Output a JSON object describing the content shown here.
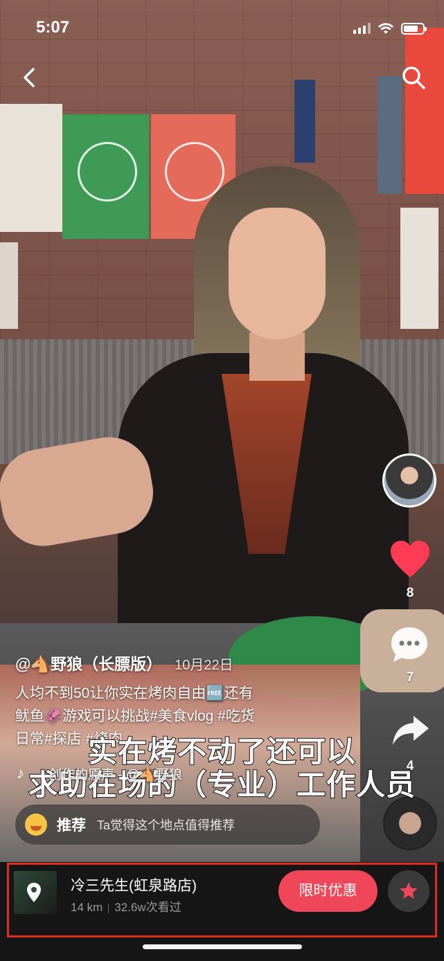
{
  "status_bar": {
    "time": "5:07",
    "battery_percent": 75
  },
  "author": {
    "handle": "@🐴野狼（长膘版）",
    "date": "10月22日"
  },
  "description": {
    "line1": "人均不到50让你实在烤肉自由🆓还有",
    "line2": "鱿鱼🦑游戏可以挑战#美食vlog #吃货",
    "line3": "日常#探店 #烤肉"
  },
  "subtitles": {
    "line1": "实在烤不动了还可以",
    "line2": "求助在场的（专业）工作人员"
  },
  "music": {
    "text": "创作的原声 - @🐴野狼"
  },
  "actions": {
    "likes": "8",
    "comments": "7",
    "shares": "4"
  },
  "recommendation": {
    "title": "推荐",
    "text": "Ta觉得这个地点值得推荐"
  },
  "shop": {
    "name": "冷三先生(虹泉路店)",
    "distance": "14 km",
    "views": "32.6w次看过",
    "promo_label": "限时优惠"
  },
  "colors": {
    "accent": "#f0465a",
    "highlight_box": "#e12b1f",
    "like": "#ff3b55"
  },
  "icons": [
    "back-icon",
    "search-icon",
    "heart-icon",
    "comment-icon",
    "share-icon",
    "music-note-icon",
    "location-pin-icon",
    "star-icon"
  ]
}
